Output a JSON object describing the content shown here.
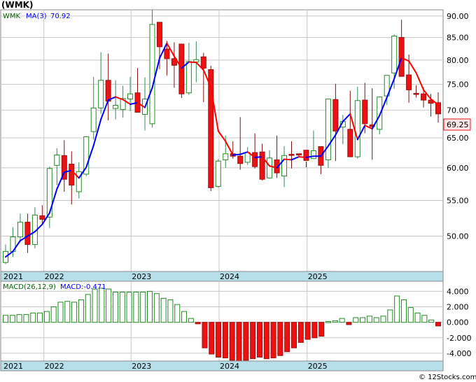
{
  "header": {
    "title": "(WMK)"
  },
  "watermark": "© 12Stocks.com",
  "price_legend": {
    "symbol": "WMK",
    "ma_label": "MA(3)",
    "ma_value": "70.92"
  },
  "macd_legend": {
    "label": "MACD(26,12,9)",
    "value_label": "MACD:-0.471"
  },
  "last_price_tag": "69.25",
  "colors": {
    "up": "#228B22",
    "down": "#EE1111",
    "ma_up": "#0000FF",
    "ma_down": "#FF0000",
    "axis_band": "#B7DFEA",
    "grid": "#C8C8C8",
    "tag_bg": "#FFE6E6",
    "tag_border": "#EE1111"
  },
  "chart_data": [
    {
      "type": "candlestick",
      "title": "(WMK)",
      "x_ticks": [
        "2021",
        "2022",
        "2023",
        "2024",
        "2025"
      ],
      "y_ticks": [
        "50.00",
        "55.00",
        "60.00",
        "65.00",
        "70.00",
        "75.00",
        "80.00",
        "85.00",
        "90.00"
      ],
      "ylim": [
        45.5,
        91.5
      ],
      "y_scale": "log",
      "legend": "top-left",
      "series": [
        {
          "name": "WMK",
          "ohlc": [
            [
              46.6,
              48.9,
              46.4,
              48.0
            ],
            [
              48.0,
              51.2,
              47.3,
              49.9
            ],
            [
              49.9,
              53.1,
              49.2,
              51.9
            ],
            [
              51.9,
              53.1,
              47.8,
              48.9
            ],
            [
              48.9,
              54.0,
              48.4,
              52.9
            ],
            [
              52.8,
              54.3,
              51.5,
              52.3
            ],
            [
              52.6,
              60.2,
              51.1,
              59.9
            ],
            [
              60.4,
              63.2,
              57.3,
              62.1
            ],
            [
              62.0,
              64.6,
              56.3,
              58.2
            ],
            [
              60.6,
              62.7,
              54.4,
              57.3
            ],
            [
              56.3,
              60.9,
              55.3,
              59.4
            ],
            [
              59.0,
              65.3,
              58.7,
              65.2
            ],
            [
              66.1,
              76.5,
              64.7,
              70.4
            ],
            [
              70.4,
              81.7,
              69.3,
              75.8
            ],
            [
              75.8,
              81.4,
              68.1,
              71.7
            ],
            [
              70.3,
              75.8,
              68.3,
              70.9
            ],
            [
              70.1,
              74.7,
              68.6,
              72.2
            ],
            [
              72.1,
              76.5,
              69.8,
              73.1
            ],
            [
              73.3,
              78.3,
              70.6,
              69.6
            ],
            [
              69.2,
              76.4,
              66.3,
              72.1
            ],
            [
              67.5,
              91.5,
              66.8,
              88.0
            ],
            [
              88.5,
              86.0,
              78.1,
              82.9
            ],
            [
              82.4,
              84.2,
              76.8,
              80.3
            ],
            [
              80.3,
              83.9,
              74.3,
              78.9
            ],
            [
              83.5,
              82.6,
              72.3,
              73.1
            ],
            [
              73.3,
              83.8,
              72.9,
              79.7
            ],
            [
              79.6,
              84.1,
              75.4,
              80.1
            ],
            [
              80.7,
              81.6,
              71.5,
              78.3
            ],
            [
              78.0,
              78.8,
              56.4,
              56.9
            ],
            [
              57.1,
              61.4,
              56.9,
              61.1
            ],
            [
              61.3,
              65.4,
              60.0,
              62.3
            ],
            [
              62.3,
              64.4,
              61.5,
              61.9
            ],
            [
              61.9,
              68.7,
              59.7,
              60.7
            ],
            [
              60.9,
              63.4,
              60.5,
              62.5
            ],
            [
              62.5,
              65.8,
              59.9,
              60.2
            ],
            [
              62.6,
              64.0,
              58.0,
              58.2
            ],
            [
              58.4,
              62.9,
              58.3,
              61.6
            ],
            [
              61.3,
              65.4,
              58.4,
              59.2
            ],
            [
              58.7,
              63.6,
              57.0,
              62.0
            ],
            [
              62.2,
              64.4,
              59.9,
              62.1
            ],
            [
              62.3,
              62.3,
              61.8,
              62.1
            ],
            [
              62.9,
              61.0,
              60.1,
              61.2
            ],
            [
              61.5,
              66.3,
              61.6,
              62.8
            ],
            [
              63.5,
              63.5,
              59.0,
              60.4
            ],
            [
              61.3,
              66.2,
              60.0,
              72.1
            ],
            [
              72.0,
              75.1,
              61.1,
              66.2
            ],
            [
              66.9,
              69.1,
              63.9,
              67.9
            ],
            [
              66.5,
              73.7,
              65.2,
              61.8
            ],
            [
              61.8,
              74.5,
              61.5,
              71.8
            ],
            [
              71.9,
              75.3,
              65.8,
              67.5
            ],
            [
              67.3,
              74.2,
              61.3,
              67.0
            ],
            [
              66.5,
              72.5,
              65.6,
              72.5
            ],
            [
              72.7,
              75.7,
              71.0,
              76.8
            ],
            [
              77.3,
              85.7,
              74.1,
              85.3
            ],
            [
              85.0,
              89.1,
              77.2,
              76.6
            ],
            [
              76.9,
              81.2,
              71.4,
              73.9
            ],
            [
              73.2,
              74.8,
              72.4,
              73.0
            ],
            [
              73.1,
              74.4,
              70.5,
              71.9
            ],
            [
              71.9,
              73.1,
              68.8,
              71.3
            ],
            [
              71.4,
              73.4,
              67.7,
              69.3
            ]
          ]
        },
        {
          "name": "MA(3)",
          "values": [
            47.3,
            48.0,
            49.4,
            50.0,
            50.6,
            51.6,
            53.2,
            56.7,
            59.3,
            59.6,
            58.4,
            60.1,
            63.7,
            68.3,
            71.9,
            72.5,
            72.0,
            71.1,
            71.4,
            70.5,
            74.3,
            80.4,
            83.7,
            80.8,
            78.3,
            79.6,
            79.5,
            77.9,
            74.4,
            66.2,
            64.4,
            62.1,
            62.2,
            62.6,
            61.7,
            61.8,
            60.3,
            60.0,
            61.4,
            61.3,
            61.8,
            61.7,
            61.9,
            61.9,
            63.6,
            65.5,
            67.9,
            69.3,
            64.7,
            67.2,
            66.6,
            69.0,
            72.4,
            76.1,
            80.5,
            79.8,
            77.3,
            73.9,
            72.1,
            71.0
          ]
        }
      ]
    },
    {
      "type": "bar",
      "title": "MACD(26,12,9)",
      "x_ticks": [
        "2021",
        "2022",
        "2023",
        "2024",
        "2025"
      ],
      "y_ticks": [
        "4.000",
        "2.000",
        "0.000",
        "-2.000",
        "-4.000"
      ],
      "ylim": [
        -5.0,
        5.3
      ],
      "legend": "top-left",
      "series": [
        {
          "name": "MACD",
          "values": [
            0.9,
            0.9,
            1.0,
            1.0,
            1.2,
            1.2,
            1.4,
            2.0,
            2.6,
            2.7,
            2.6,
            2.9,
            3.6,
            4.3,
            4.4,
            4.3,
            3.9,
            3.9,
            3.9,
            3.9,
            3.9,
            4.0,
            3.7,
            3.1,
            2.9,
            2.3,
            1.4,
            0.5,
            -0.2,
            -3.3,
            -4.1,
            -4.5,
            -4.6,
            -4.9,
            -5.0,
            -4.9,
            -4.7,
            -4.5,
            -4.7,
            -4.6,
            -4.3,
            -3.8,
            -3.3,
            -2.6,
            -2.2,
            -2.0,
            -1.8,
            0.1,
            0.2,
            0.5,
            -0.3,
            0.6,
            0.6,
            0.8,
            0.6,
            0.8,
            1.6,
            3.4,
            2.9,
            1.9,
            1.2,
            0.9,
            0.3,
            -0.471
          ]
        }
      ]
    }
  ]
}
